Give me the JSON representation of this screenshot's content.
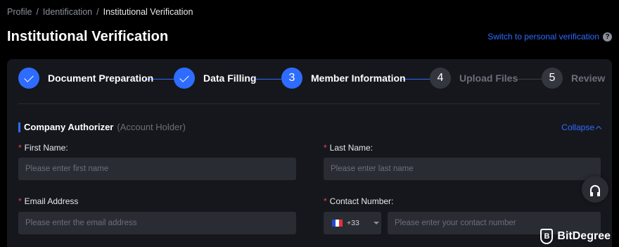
{
  "breadcrumb": {
    "items": [
      "Profile",
      "Identification",
      "Institutional Verification"
    ],
    "separator": "/"
  },
  "page_title": "Institutional Verification",
  "switch_link": "Switch to personal verification",
  "help_icon": "?",
  "steps": [
    {
      "number": "1",
      "label": "Document Preparation",
      "state": "done"
    },
    {
      "number": "2",
      "label": "Data Filling",
      "state": "done"
    },
    {
      "number": "3",
      "label": "Member Information",
      "state": "active"
    },
    {
      "number": "4",
      "label": "Upload Files",
      "state": "pending"
    },
    {
      "number": "5",
      "label": "Review",
      "state": "pending"
    }
  ],
  "section": {
    "title": "Company Authorizer",
    "subtitle": "(Account Holder)",
    "collapse_label": "Collapse"
  },
  "form": {
    "required_mark": "*",
    "first_name": {
      "label": "First Name:",
      "placeholder": "Please enter first name"
    },
    "last_name": {
      "label": "Last Name:",
      "placeholder": "Please enter last name"
    },
    "email": {
      "label": "Email Address",
      "placeholder": "Please enter the email address"
    },
    "contact": {
      "label": "Contact Number:",
      "country_code": "+33",
      "country_flag": "france-flag",
      "placeholder": "Please enter your contact number"
    }
  },
  "watermark": {
    "text": "BitDegree",
    "logo_letter": "B"
  },
  "colors": {
    "accent": "#2e6cff",
    "background": "#000000",
    "card": "#16171d",
    "input": "#2a2c33",
    "required": "#e8474c"
  }
}
